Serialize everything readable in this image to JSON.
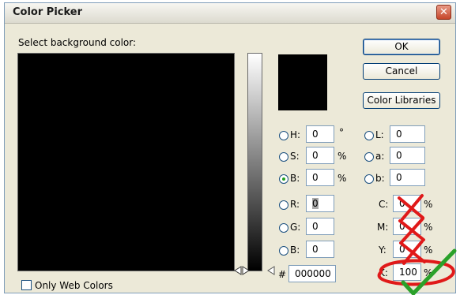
{
  "window": {
    "title": "Color Picker",
    "close_glyph": "✕"
  },
  "prompt": "Select background color:",
  "buttons": {
    "ok": "OK",
    "cancel": "Cancel",
    "libraries": "Color Libraries"
  },
  "hsb": {
    "h": {
      "label": "H:",
      "value": "0",
      "unit": "°"
    },
    "s": {
      "label": "S:",
      "value": "0",
      "unit": "%"
    },
    "b": {
      "label": "B:",
      "value": "0",
      "unit": "%"
    }
  },
  "lab": {
    "l": {
      "label": "L:",
      "value": "0"
    },
    "a": {
      "label": "a:",
      "value": "0"
    },
    "b": {
      "label": "b:",
      "value": "0"
    }
  },
  "rgb": {
    "r": {
      "label": "R:",
      "value": "0"
    },
    "g": {
      "label": "G:",
      "value": "0"
    },
    "b": {
      "label": "B:",
      "value": "0"
    }
  },
  "cmyk": {
    "c": {
      "label": "C:",
      "value": "0",
      "unit": "%"
    },
    "m": {
      "label": "M:",
      "value": "0",
      "unit": "%"
    },
    "y": {
      "label": "Y:",
      "value": "0",
      "unit": "%"
    },
    "k": {
      "label": "K:",
      "value": "100",
      "unit": "%"
    }
  },
  "hex": {
    "label": "#",
    "value": "000000"
  },
  "web_colors": {
    "label": "Only Web Colors",
    "checked": false
  },
  "selected_mode": "B",
  "current_color": "#000000",
  "annotation_colors": {
    "cross": "#e01919",
    "circle": "#e01919",
    "check": "#2aa12a"
  }
}
